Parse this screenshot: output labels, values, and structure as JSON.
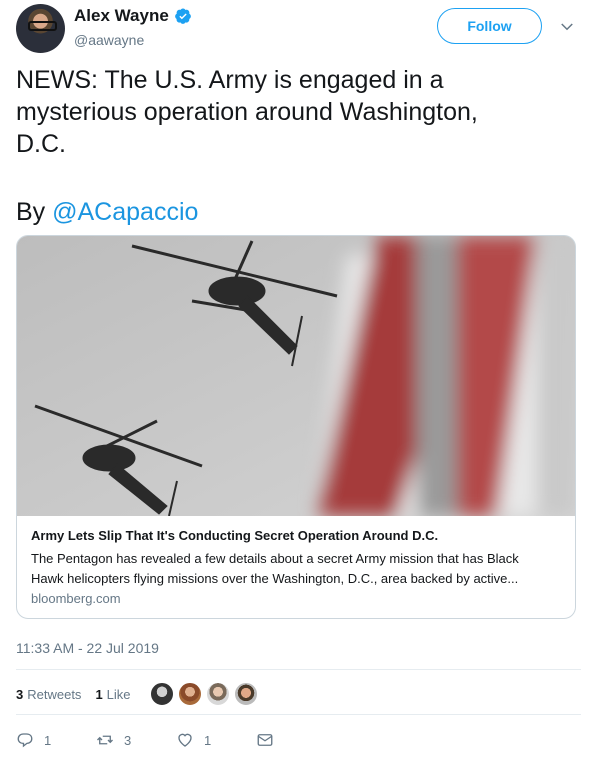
{
  "author": {
    "name": "Alex Wayne",
    "handle": "@aawayne",
    "verified_icon": "verified-badge-icon",
    "follow_label": "Follow"
  },
  "tweet": {
    "text_lines": [
      "NEWS: The U.S. Army is engaged in a",
      "mysterious operation around Washington,",
      "D.C."
    ],
    "by_prefix": "By ",
    "mention": "@ACapaccio"
  },
  "card": {
    "title": "Army Lets Slip That It's Conducting Secret Operation Around D.C.",
    "description_lines": [
      "The Pentagon has revealed a few details about a secret Army mission that has Black",
      "Hawk helicopters flying missions over the Washington, D.C., area backed by active..."
    ],
    "domain": "bloomberg.com"
  },
  "timestamp": "11:33 AM - 22 Jul 2019",
  "stats": {
    "retweets_count": "3",
    "retweets_label": "Retweets",
    "likes_count": "1",
    "likes_label": "Like"
  },
  "actions": {
    "reply_count": "1",
    "retweet_count": "3",
    "like_count": "1"
  },
  "colors": {
    "accent": "#1da1f2",
    "link": "#1b95e0",
    "muted": "#657786",
    "border": "#ccd6dd"
  }
}
